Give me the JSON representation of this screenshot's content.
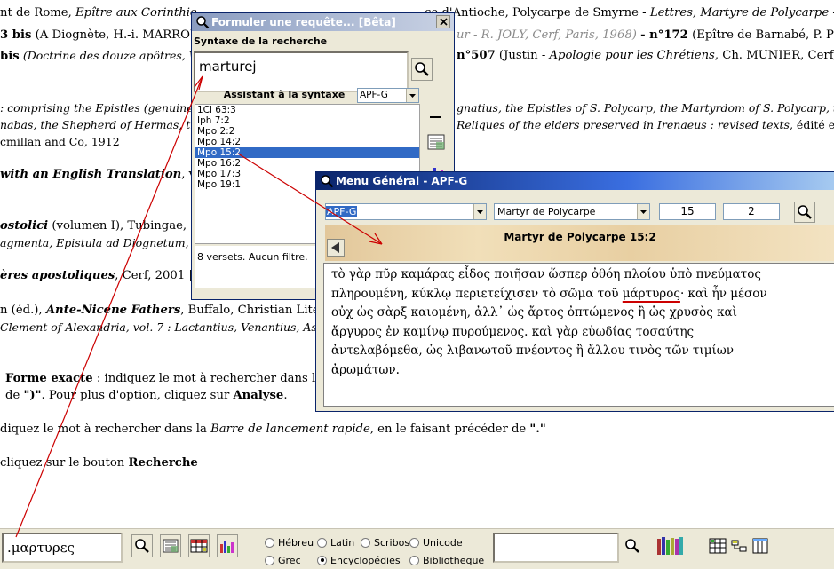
{
  "document": {
    "line1a": "nt de Rome,",
    "line1b": "Epître aux Corinthie",
    "line1c": "ce d'Antioche, Polycarpe de Smyrne -",
    "line1d": "Lettres, Martyre de Polycarpe -",
    "line2a": "3 bis",
    "line2b": "(A Diognète, H.-i. MARROU,",
    "line2c": "ur - R. JOLY, Cerf, Paris, 1968)",
    "line2d": "- n°172",
    "line2e": "(Epître de Barnabé, P. PRIGE",
    "line3a": "bis",
    "line3b": "(Doctrine des douze apôtres, W.",
    "line3c": "n°507",
    "line3d": "(Justin -",
    "line3e": "Apologie pour les Chrétiens",
    "line3f": ", Ch. MUNIER, Cerf, Paris,",
    "line4a": ": comprising the Epistles (genuine a",
    "line4b": "gnatius, the Epistles of S. Polycarp, the Martyrdom of S. Polycarp, the",
    "line5a": "nabas, the Shepherd of Hermas, the",
    "line5b": "Reliques of the elders preserved in Irenaeus : revised texts,",
    "line5c": "édité et",
    "line6": "cmillan and Co, 1912",
    "line7a": "with an English Translation",
    "line7b": ", vo",
    "line8a": "ostolici",
    "line8b": "(volumen I), Tubingae, 19",
    "line9": "agmenta, Epistula ad Diognetum, Pa",
    "line10a": "ères apostoliques",
    "line10b": ", Cerf, 2001 | F",
    "line11a": "n (éd.),",
    "line11b": "Ante-Nicene Fathers",
    "line11c": ", Buffalo, Christian Literat",
    "line12": "Clement of Alexandria, vol. 7 : Lactantius, Venantius, Aster",
    "line13a": "Forme exacte",
    "line13b": ": indiquez le mot à rechercher dans la",
    "line14a": "de",
    "line14b": "\")\"",
    "line14c": ". Pour plus d'option, cliquez sur",
    "line14d": "Analyse",
    "line15a": "diquez le mot à rechercher dans la",
    "line15b": "Barre de lancement rapide",
    "line15c": ", en le faisant précéder de",
    "line15d": "\".\"",
    "line16a": "cliquez sur le bouton",
    "line16b": "Recherche"
  },
  "requete_window": {
    "title": "Formuler une requête... [Bêta]",
    "syntax_label": "Syntaxe de la recherche",
    "query_value": "marturej",
    "assist_label": "Assistant à la syntaxe",
    "corpus_selected": "APF-G",
    "results": [
      "1Cl 63:3",
      "Iph 7:2",
      "Mpo 2:2",
      "Mpo 14:2",
      "Mpo 15:2",
      "Mpo 16:2",
      "Mpo 17:3",
      "Mpo 19:1"
    ],
    "selected_result": "Mpo 15:2",
    "status": "8 versets. Aucun filtre."
  },
  "menu_window": {
    "title": "Menu Général - APF-G",
    "corpus": "APF-G",
    "author": "Martyr de Polycarpe",
    "chapter": "15",
    "verse": "2",
    "passage_title": "Martyr de Polycarpe 15:2",
    "greek_lines": [
      "τὸ γὰρ πῦρ καμάρας εἶδος ποιῆσαν ὥσπερ ὀθόη πλοίου ὑπὸ πνεύματος",
      "πληρουμένη, κύκλῳ περιετείχισεν τὸ σῶμα τοῦ",
      "οὐχ ὡς σὰρξ καιομένη, ἀλλ᾽ ὡς ἄρτος ὀπτώμενος ἢ ὡς χρυσὸς καὶ",
      "ἄργυρος ἐν καμίνῳ πυρούμενος. καὶ γὰρ εὐωδίας τοσαύτης",
      "ἀντελαβόμεθα, ὡς λιβανωτοῦ πνέοντος ἢ ἄλλου τινὸς τῶν τιμίων",
      "ἀρωμάτων."
    ],
    "highlighted_word": "μάρτυρος",
    "line2_tail": "· καὶ ἦν μέσον"
  },
  "bottom_bar": {
    "greek_input": ".μαρτυρες",
    "radios": [
      {
        "label": "Hébreu",
        "checked": false
      },
      {
        "label": "Latin",
        "checked": false
      },
      {
        "label": "Scribos",
        "checked": false
      },
      {
        "label": "Unicode",
        "checked": false
      },
      {
        "label": "Grec",
        "checked": false
      },
      {
        "label": "Encyclopédies",
        "checked": true
      },
      {
        "label": "Bibliotheque",
        "checked": false
      }
    ],
    "search_right_value": ""
  },
  "colors": {
    "arrow": "#cc0000",
    "selection": "#316ac5",
    "title_active": "#0a246a"
  }
}
